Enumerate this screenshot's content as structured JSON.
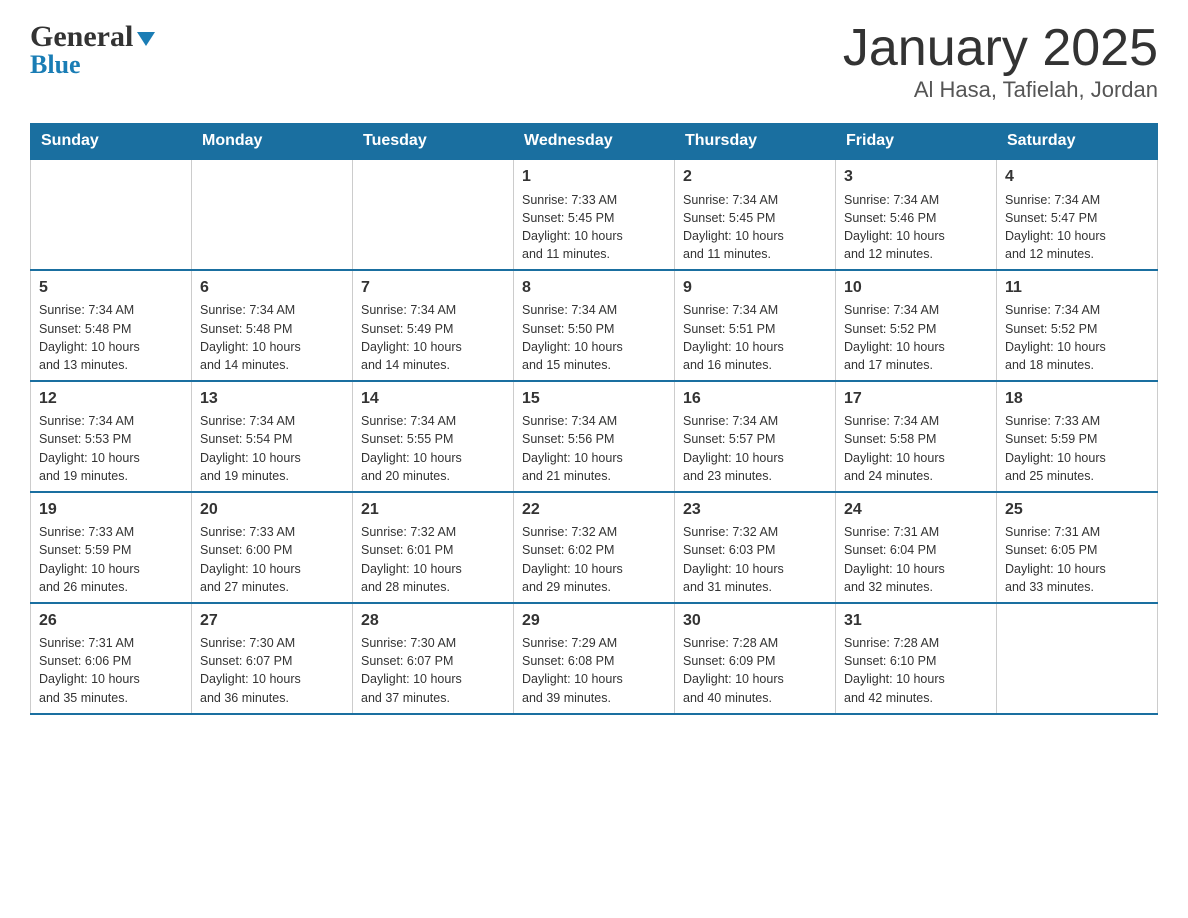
{
  "logo": {
    "general": "General",
    "blue": "Blue"
  },
  "title": "January 2025",
  "subtitle": "Al Hasa, Tafielah, Jordan",
  "days": [
    "Sunday",
    "Monday",
    "Tuesday",
    "Wednesday",
    "Thursday",
    "Friday",
    "Saturday"
  ],
  "weeks": [
    [
      {
        "day": "",
        "info": ""
      },
      {
        "day": "",
        "info": ""
      },
      {
        "day": "",
        "info": ""
      },
      {
        "day": "1",
        "info": "Sunrise: 7:33 AM\nSunset: 5:45 PM\nDaylight: 10 hours\nand 11 minutes."
      },
      {
        "day": "2",
        "info": "Sunrise: 7:34 AM\nSunset: 5:45 PM\nDaylight: 10 hours\nand 11 minutes."
      },
      {
        "day": "3",
        "info": "Sunrise: 7:34 AM\nSunset: 5:46 PM\nDaylight: 10 hours\nand 12 minutes."
      },
      {
        "day": "4",
        "info": "Sunrise: 7:34 AM\nSunset: 5:47 PM\nDaylight: 10 hours\nand 12 minutes."
      }
    ],
    [
      {
        "day": "5",
        "info": "Sunrise: 7:34 AM\nSunset: 5:48 PM\nDaylight: 10 hours\nand 13 minutes."
      },
      {
        "day": "6",
        "info": "Sunrise: 7:34 AM\nSunset: 5:48 PM\nDaylight: 10 hours\nand 14 minutes."
      },
      {
        "day": "7",
        "info": "Sunrise: 7:34 AM\nSunset: 5:49 PM\nDaylight: 10 hours\nand 14 minutes."
      },
      {
        "day": "8",
        "info": "Sunrise: 7:34 AM\nSunset: 5:50 PM\nDaylight: 10 hours\nand 15 minutes."
      },
      {
        "day": "9",
        "info": "Sunrise: 7:34 AM\nSunset: 5:51 PM\nDaylight: 10 hours\nand 16 minutes."
      },
      {
        "day": "10",
        "info": "Sunrise: 7:34 AM\nSunset: 5:52 PM\nDaylight: 10 hours\nand 17 minutes."
      },
      {
        "day": "11",
        "info": "Sunrise: 7:34 AM\nSunset: 5:52 PM\nDaylight: 10 hours\nand 18 minutes."
      }
    ],
    [
      {
        "day": "12",
        "info": "Sunrise: 7:34 AM\nSunset: 5:53 PM\nDaylight: 10 hours\nand 19 minutes."
      },
      {
        "day": "13",
        "info": "Sunrise: 7:34 AM\nSunset: 5:54 PM\nDaylight: 10 hours\nand 19 minutes."
      },
      {
        "day": "14",
        "info": "Sunrise: 7:34 AM\nSunset: 5:55 PM\nDaylight: 10 hours\nand 20 minutes."
      },
      {
        "day": "15",
        "info": "Sunrise: 7:34 AM\nSunset: 5:56 PM\nDaylight: 10 hours\nand 21 minutes."
      },
      {
        "day": "16",
        "info": "Sunrise: 7:34 AM\nSunset: 5:57 PM\nDaylight: 10 hours\nand 23 minutes."
      },
      {
        "day": "17",
        "info": "Sunrise: 7:34 AM\nSunset: 5:58 PM\nDaylight: 10 hours\nand 24 minutes."
      },
      {
        "day": "18",
        "info": "Sunrise: 7:33 AM\nSunset: 5:59 PM\nDaylight: 10 hours\nand 25 minutes."
      }
    ],
    [
      {
        "day": "19",
        "info": "Sunrise: 7:33 AM\nSunset: 5:59 PM\nDaylight: 10 hours\nand 26 minutes."
      },
      {
        "day": "20",
        "info": "Sunrise: 7:33 AM\nSunset: 6:00 PM\nDaylight: 10 hours\nand 27 minutes."
      },
      {
        "day": "21",
        "info": "Sunrise: 7:32 AM\nSunset: 6:01 PM\nDaylight: 10 hours\nand 28 minutes."
      },
      {
        "day": "22",
        "info": "Sunrise: 7:32 AM\nSunset: 6:02 PM\nDaylight: 10 hours\nand 29 minutes."
      },
      {
        "day": "23",
        "info": "Sunrise: 7:32 AM\nSunset: 6:03 PM\nDaylight: 10 hours\nand 31 minutes."
      },
      {
        "day": "24",
        "info": "Sunrise: 7:31 AM\nSunset: 6:04 PM\nDaylight: 10 hours\nand 32 minutes."
      },
      {
        "day": "25",
        "info": "Sunrise: 7:31 AM\nSunset: 6:05 PM\nDaylight: 10 hours\nand 33 minutes."
      }
    ],
    [
      {
        "day": "26",
        "info": "Sunrise: 7:31 AM\nSunset: 6:06 PM\nDaylight: 10 hours\nand 35 minutes."
      },
      {
        "day": "27",
        "info": "Sunrise: 7:30 AM\nSunset: 6:07 PM\nDaylight: 10 hours\nand 36 minutes."
      },
      {
        "day": "28",
        "info": "Sunrise: 7:30 AM\nSunset: 6:07 PM\nDaylight: 10 hours\nand 37 minutes."
      },
      {
        "day": "29",
        "info": "Sunrise: 7:29 AM\nSunset: 6:08 PM\nDaylight: 10 hours\nand 39 minutes."
      },
      {
        "day": "30",
        "info": "Sunrise: 7:28 AM\nSunset: 6:09 PM\nDaylight: 10 hours\nand 40 minutes."
      },
      {
        "day": "31",
        "info": "Sunrise: 7:28 AM\nSunset: 6:10 PM\nDaylight: 10 hours\nand 42 minutes."
      },
      {
        "day": "",
        "info": ""
      }
    ]
  ]
}
